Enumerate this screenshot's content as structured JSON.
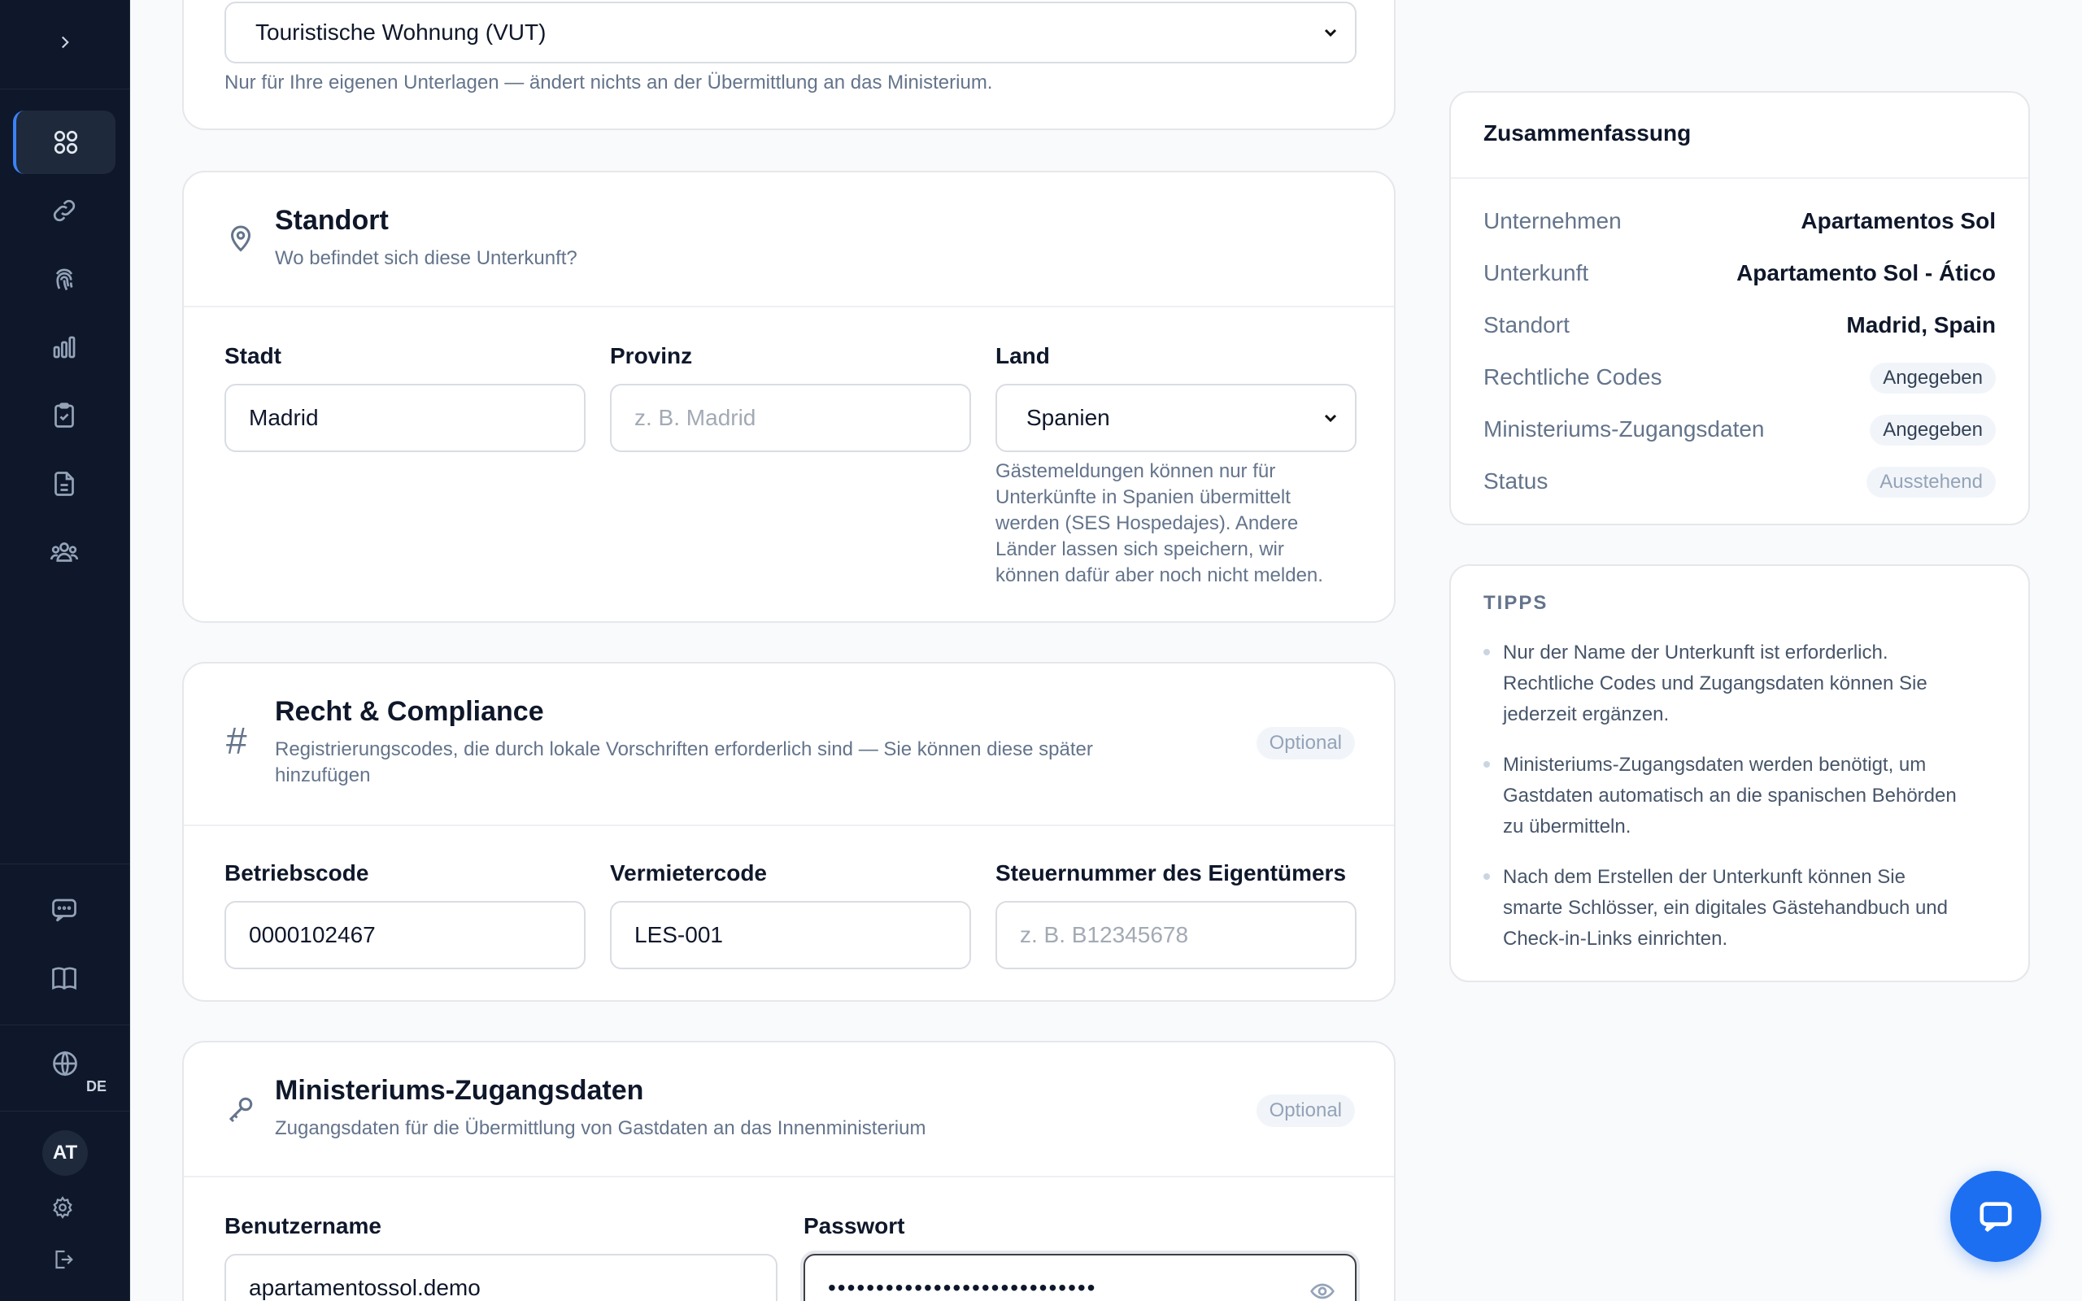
{
  "property_type": {
    "value": "Touristische Wohnung (VUT)",
    "help": "Nur für Ihre eigenen Unterlagen — ändert nichts an der Übermittlung an das Ministerium."
  },
  "location": {
    "title": "Standort",
    "subtitle": "Wo befindet sich diese Unterkunft?",
    "city_label": "Stadt",
    "city_value": "Madrid",
    "province_label": "Provinz",
    "province_placeholder": "z. B. Madrid",
    "country_label": "Land",
    "country_value": "Spanien",
    "country_help": [
      "Gästemeldungen können nur für",
      "Unterkünfte in Spanien übermittelt",
      "werden (SES Hospedajes). Andere",
      "Länder lassen sich speichern, wir",
      "können dafür aber noch nicht melden."
    ]
  },
  "compliance": {
    "title": "Recht & Compliance",
    "subtitle": [
      "Registrierungscodes, die durch lokale Vorschriften erforderlich sind — Sie können diese später",
      "hinzufügen"
    ],
    "badge": "Optional",
    "business_code_label": "Betriebscode",
    "business_code_value": "0000102467",
    "landlord_code_label": "Vermietercode",
    "landlord_code_value": "LES-001",
    "tax_label": "Steuernummer des Eigentümers",
    "tax_placeholder": "z. B. B12345678"
  },
  "ministry": {
    "title": "Ministeriums-Zugangsdaten",
    "subtitle": "Zugangsdaten für die Übermittlung von Gastdaten an das Innenministerium",
    "badge": "Optional",
    "username_label": "Benutzername",
    "username_value": "apartamentossol.demo",
    "password_label": "Passwort",
    "password_value": "••••••••••••••••••••••••••••"
  },
  "summary": {
    "title": "Zusammenfassung",
    "rows": [
      {
        "key": "Unternehmen",
        "value": "Apartamentos Sol"
      },
      {
        "key": "Unterkunft",
        "value": "Apartamento Sol - Ático"
      },
      {
        "key": "Standort",
        "value": "Madrid, Spain"
      },
      {
        "key": "Rechtliche Codes",
        "value": "Angegeben"
      },
      {
        "key": "Ministeriums-Zugangsdaten",
        "value": "Angegeben"
      },
      {
        "key": "Status",
        "value": "Ausstehend"
      }
    ]
  },
  "tips": {
    "title": "TIPPS",
    "items": [
      [
        "Nur der Name der Unterkunft ist erforderlich.",
        "Rechtliche Codes und Zugangsdaten können Sie",
        "jederzeit ergänzen."
      ],
      [
        "Ministeriums-Zugangsdaten werden benötigt, um",
        "Gastdaten automatisch an die spanischen Behörden",
        "zu übermitteln."
      ],
      [
        "Nach dem Erstellen der Unterkunft können Sie",
        "smarte Schlösser, ein digitales Gästehandbuch und",
        "Check-in-Links einrichten."
      ]
    ]
  },
  "sidebar": {
    "language": "DE",
    "avatar_initials": "AT"
  },
  "colors": {
    "sidebar_bg": "#0f172a",
    "accent": "#1d6ff2"
  }
}
